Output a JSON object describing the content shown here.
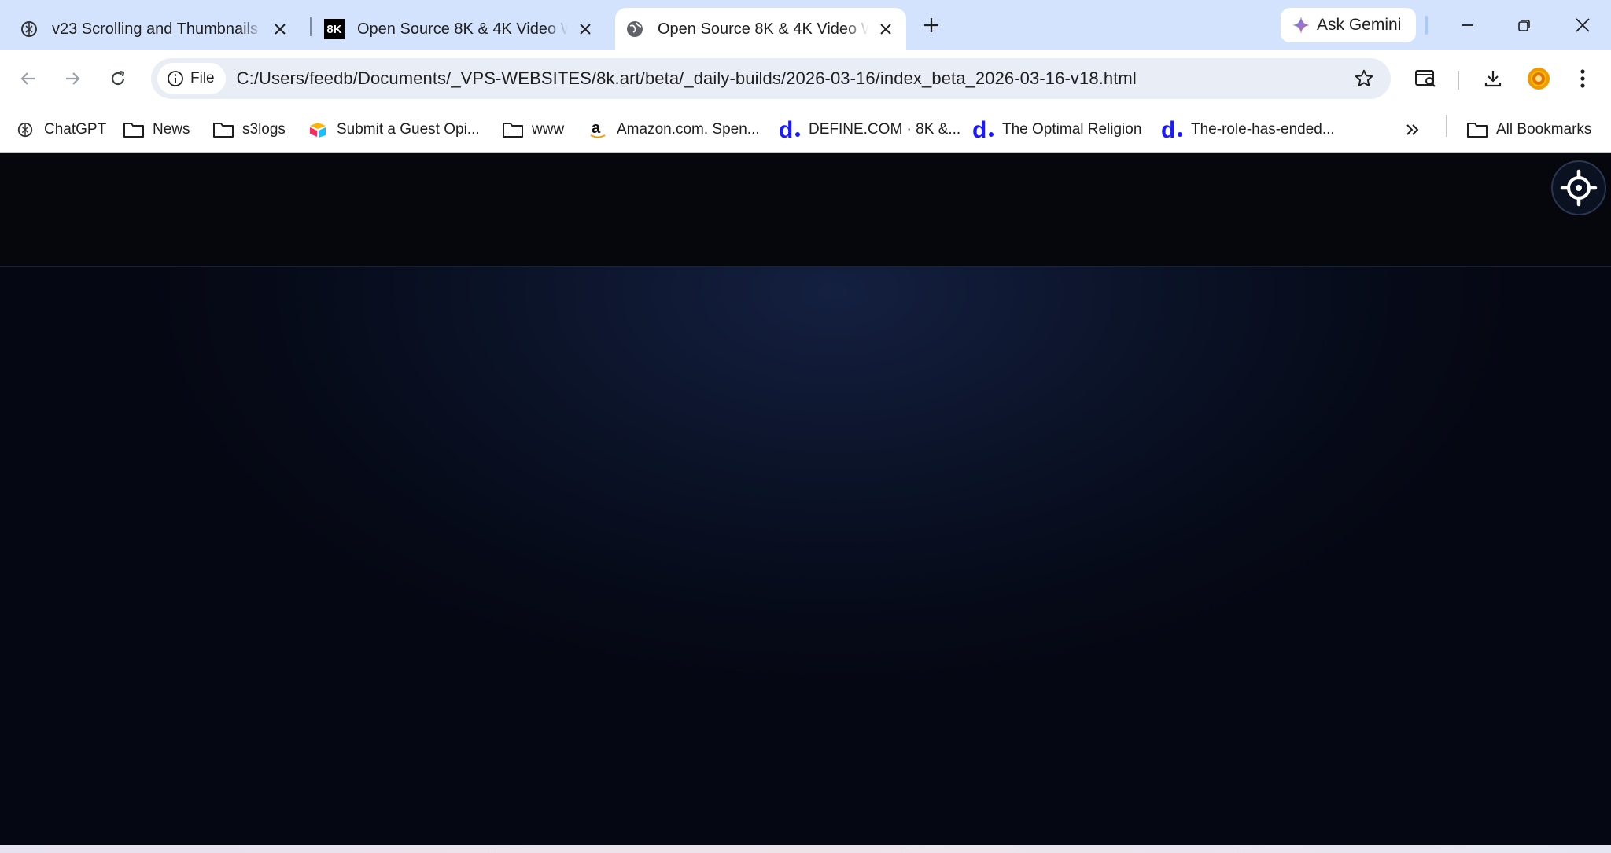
{
  "tabs": [
    {
      "title": "v23 Scrolling and Thumbnails Fi",
      "favicon": "chatgpt-icon",
      "active": false
    },
    {
      "title": "Open Source 8K & 4K Video Wa",
      "favicon": "8k-logo",
      "favicon_text": "8K",
      "active": false
    },
    {
      "title": "Open Source 8K & 4K Video Wa",
      "favicon": "globe-icon",
      "active": true
    }
  ],
  "gemini": {
    "label": "Ask Gemini"
  },
  "omnibox": {
    "chip_label": "File",
    "url": "C:/Users/feedb/Documents/_VPS-WEBSITES/8k.art/beta/_daily-builds/2026-03-16/index_beta_2026-03-16-v18.html"
  },
  "bookmarks": [
    {
      "label": "ChatGPT",
      "icon": "chatgpt-icon"
    },
    {
      "label": "News",
      "icon": "folder-icon"
    },
    {
      "label": "s3logs",
      "icon": "folder-icon"
    },
    {
      "label": "Submit a Guest Opi...",
      "icon": "airtable-icon"
    },
    {
      "label": "www",
      "icon": "folder-icon"
    },
    {
      "label": "Amazon.com. Spen...",
      "icon": "amazon-icon"
    },
    {
      "label": "DEFINE.COM · 8K &...",
      "icon": "define-d-icon"
    },
    {
      "label": "The Optimal Religion",
      "icon": "define-d-icon"
    },
    {
      "label": "The-role-has-ended...",
      "icon": "define-d-icon"
    }
  ],
  "all_bookmarks": {
    "label": "All Bookmarks"
  },
  "colors": {
    "tabstrip": "#d3e3fd",
    "page_background": "#050813",
    "define_blue": "#1a1aff"
  }
}
